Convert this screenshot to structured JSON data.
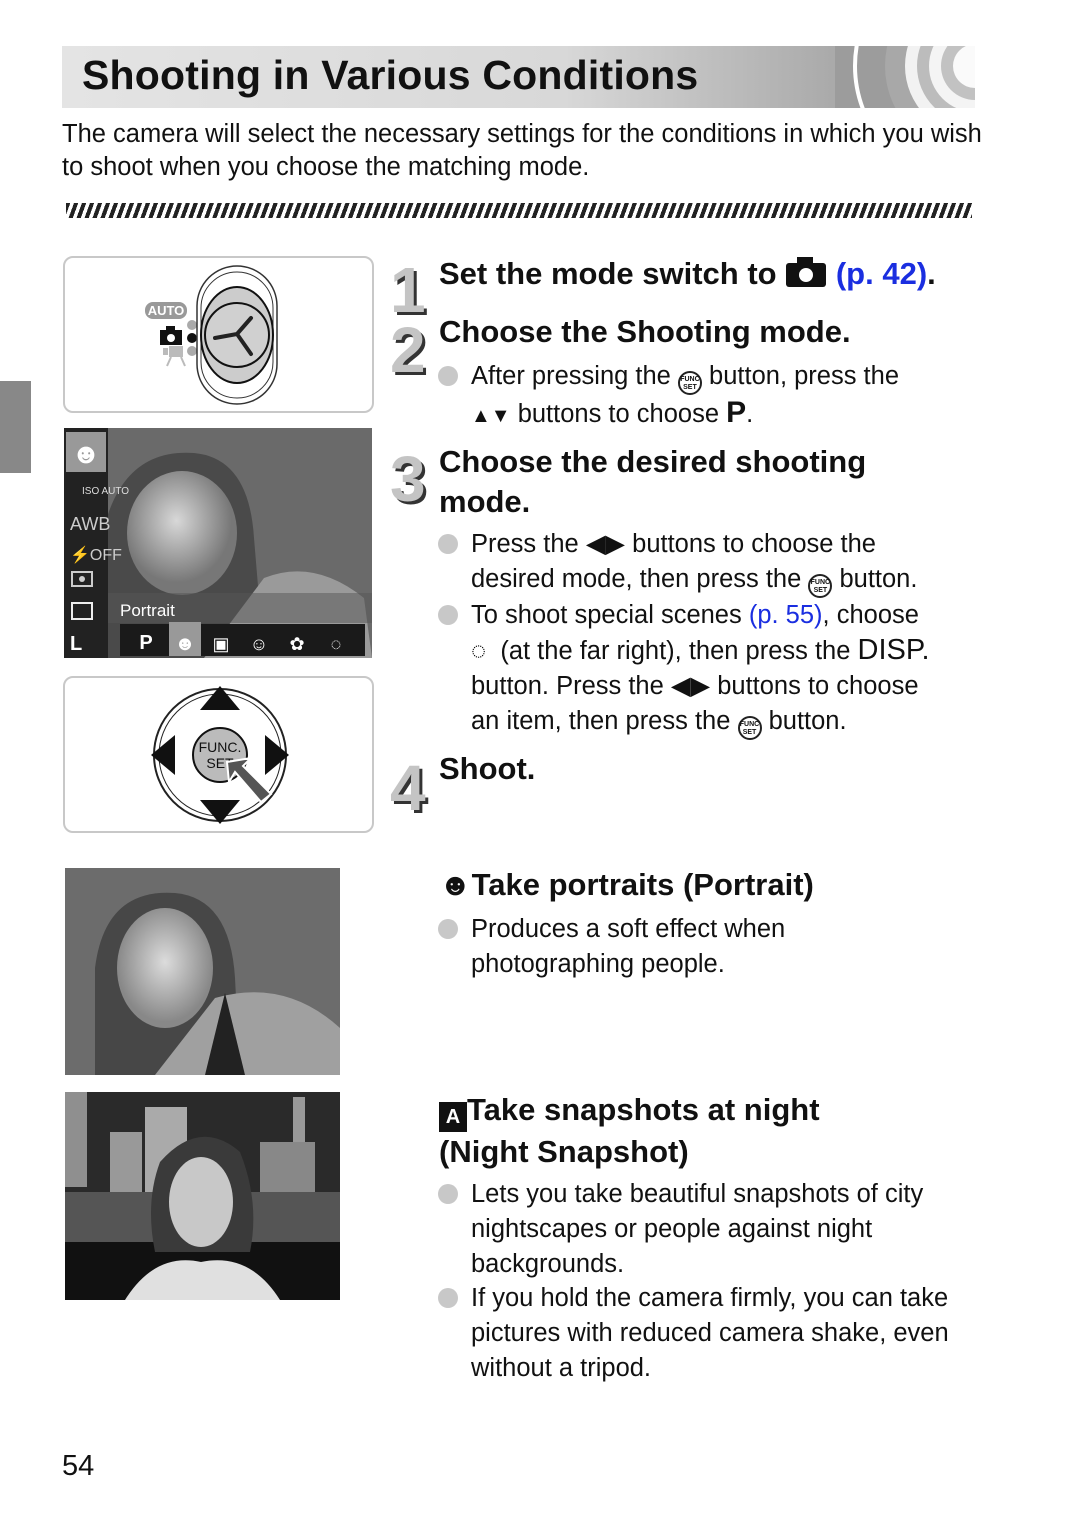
{
  "page": {
    "title": "Shooting in Various Conditions",
    "intro": "The camera will select the necessary settings for the conditions in which you wish to shoot when you choose the matching mode.",
    "page_number": "54"
  },
  "colors": {
    "link": "#1a2ee0",
    "side_tab": "#888888",
    "bullet": "#c8c8c8"
  },
  "illustrations": {
    "mode_switch": {
      "labels": [
        "AUTO"
      ],
      "selected": "camera-mode"
    },
    "lcd": {
      "left_icons": [
        "ISO AUTO",
        "AWB",
        "flash OFF",
        "metering",
        "drive single",
        "L"
      ],
      "mode_label": "Portrait",
      "mode_bar": [
        "P",
        "portrait",
        "night-snapshot",
        "kids-pets",
        "indoor",
        "scene"
      ],
      "selected_mode": "portrait"
    },
    "control_dial": {
      "center_label_1": "FUNC.",
      "center_label_2": "SET"
    }
  },
  "steps": [
    {
      "num": "1",
      "heading": "Set the mode switch to",
      "icon": "camera-icon",
      "link": "(p. 42)",
      "end": "."
    },
    {
      "num": "2",
      "heading": "Choose the Shooting mode.",
      "bullets": [
        {
          "t1": "After pressing the",
          "t2": "button, press the",
          "t3": "buttons to choose",
          "t4": "."
        }
      ]
    },
    {
      "num": "3",
      "heading_1": "Choose the desired shooting",
      "heading_2": "mode.",
      "bullets": [
        {
          "t1": "Press the",
          "t2": "buttons to choose the",
          "t3": "desired mode, then press the",
          "t4": "button."
        },
        {
          "t1": "To shoot special scenes",
          "link": "(p. 55)",
          "t2": ", choose",
          "t3": "(at the far right), then press the",
          "disp": "DISP.",
          "t4": "button. Press the",
          "t5": "buttons to choose",
          "t6": "an item, then press the",
          "t7": "button."
        }
      ]
    },
    {
      "num": "4",
      "heading": "Shoot."
    }
  ],
  "modes": [
    {
      "icon": "portrait-icon",
      "heading": "Take portraits (Portrait)",
      "bullets": [
        "Produces a soft effect when photographing people."
      ]
    },
    {
      "icon": "night-snapshot-icon",
      "heading_1": "Take snapshots at night",
      "heading_2": "(Night Snapshot)",
      "bullets": [
        "Lets you take beautiful snapshots of city nightscapes or people against night backgrounds.",
        "If you hold the camera firmly, you can take pictures with reduced camera shake, even without a tripod."
      ]
    }
  ]
}
